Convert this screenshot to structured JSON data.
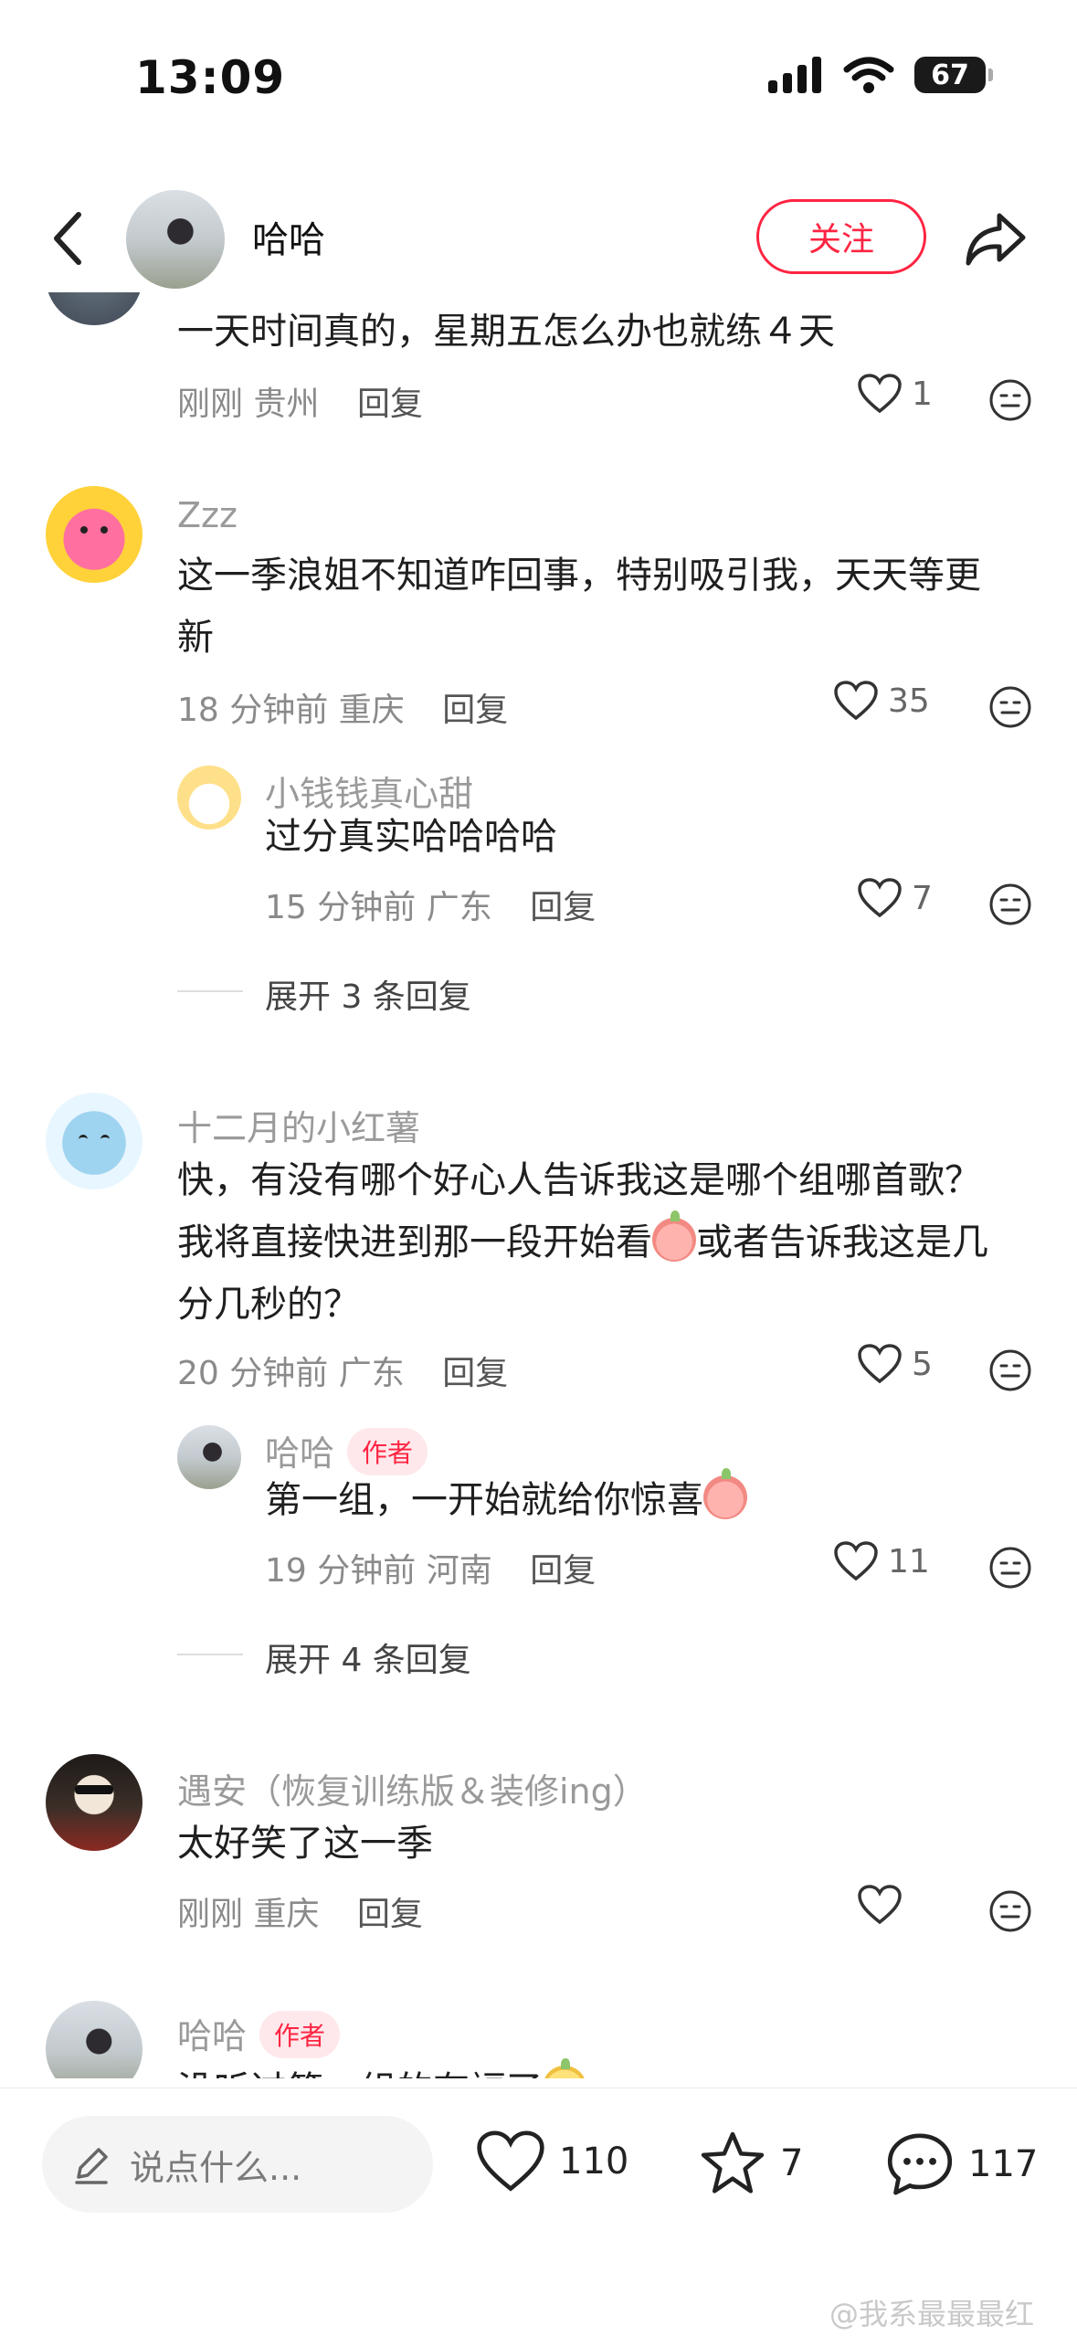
{
  "status_bar": {
    "time": "13:09",
    "battery": "67"
  },
  "header": {
    "name": "哈哈",
    "follow_label": "关注"
  },
  "comments": [
    {
      "text": "一天时间真的，星期五怎么办也就练４天",
      "time": "刚刚",
      "location": "贵州",
      "reply_label": "回复",
      "likes": "1"
    },
    {
      "username": "Zzz",
      "text_line1": "这一季浪姐不知道咋回事，特别吸引我，天天等更",
      "text_line2": "新",
      "time": "18 分钟前",
      "location": "重庆",
      "reply_label": "回复",
      "likes": "35",
      "reply": {
        "username": "小钱钱真心甜",
        "text": "过分真实哈哈哈哈",
        "time": "15 分钟前",
        "location": "广东",
        "reply_label": "回复",
        "likes": "7"
      },
      "expand": "展开 3 条回复"
    },
    {
      "username": "十二月的小红薯",
      "text_line1": "快，有没有哪个好心人告诉我这是哪个组哪首歌？",
      "text_line2a": "我将直接快进到那一段开始看",
      "text_line2b": "或者告诉我这是几",
      "text_line3": "分几秒的？",
      "time": "20 分钟前",
      "location": "广东",
      "reply_label": "回复",
      "likes": "5",
      "reply": {
        "username": "哈哈",
        "badge": "作者",
        "text": "第一组，一开始就给你惊喜",
        "time": "19 分钟前",
        "location": "河南",
        "reply_label": "回复",
        "likes": "11"
      },
      "expand": "展开 4 条回复"
    },
    {
      "username": "遇安（恢复训练版＆装修ing）",
      "text": "太好笑了这一季",
      "time": "刚刚",
      "location": "重庆",
      "reply_label": "回复"
    },
    {
      "username": "哈哈",
      "badge": "作者",
      "text": "没听过第一组的有福了"
    }
  ],
  "bottom_bar": {
    "input_placeholder": "说点什么...",
    "likes": "110",
    "collects": "7",
    "comments": "117"
  },
  "watermark": "@我系最最最红",
  "colors": {
    "accent": "#ff2442",
    "muted": "#8a8a8a"
  }
}
